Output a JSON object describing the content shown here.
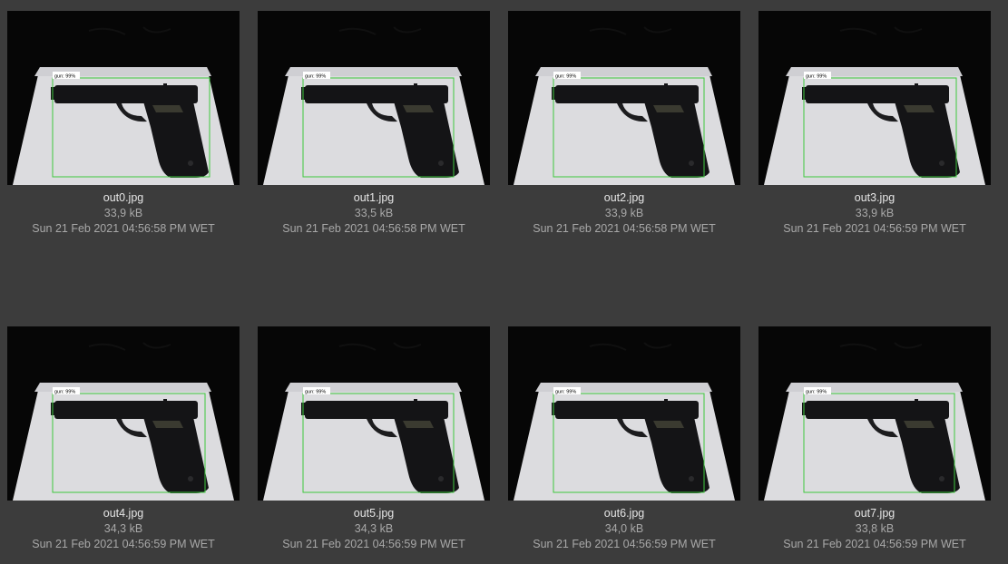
{
  "files": [
    {
      "name": "out0.jpg",
      "size": "33,9 kB",
      "date": "Sun 21 Feb 2021 04:56:58 PM WET",
      "label": "gun: 99%"
    },
    {
      "name": "out1.jpg",
      "size": "33,5 kB",
      "date": "Sun 21 Feb 2021 04:56:58 PM WET",
      "label": "gun: 99%"
    },
    {
      "name": "out2.jpg",
      "size": "33,9 kB",
      "date": "Sun 21 Feb 2021 04:56:58 PM WET",
      "label": "gun: 99%"
    },
    {
      "name": "out3.jpg",
      "size": "33,9 kB",
      "date": "Sun 21 Feb 2021 04:56:59 PM WET",
      "label": "gun: 99%"
    },
    {
      "name": "out4.jpg",
      "size": "34,3 kB",
      "date": "Sun 21 Feb 2021 04:56:59 PM WET",
      "label": "gun: 99%"
    },
    {
      "name": "out5.jpg",
      "size": "34,3 kB",
      "date": "Sun 21 Feb 2021 04:56:59 PM WET",
      "label": "gun: 99%"
    },
    {
      "name": "out6.jpg",
      "size": "34,0 kB",
      "date": "Sun 21 Feb 2021 04:56:59 PM WET",
      "label": "gun: 99%"
    },
    {
      "name": "out7.jpg",
      "size": "33,8 kB",
      "date": "Sun 21 Feb 2021 04:56:59 PM WET",
      "label": "gun: 99%"
    }
  ],
  "colors": {
    "background": "#3c3c3c",
    "detection_box": "#3ec93e"
  },
  "icons": {
    "thumbnail_subject": "pistol-icon"
  }
}
